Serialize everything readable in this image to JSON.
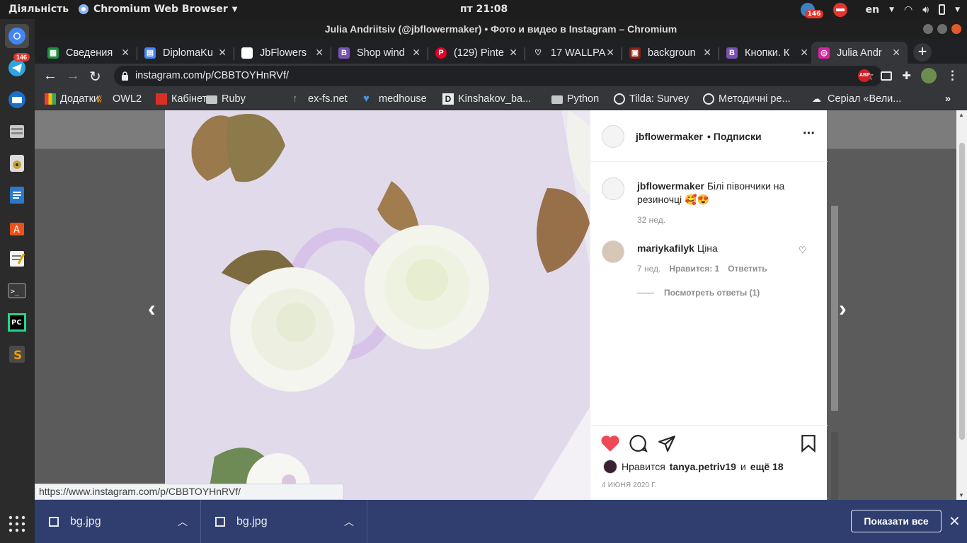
{
  "topbar": {
    "activities": "Діяльність",
    "app_name": "Chromium Web Browser",
    "clock": "пт 21:08",
    "lang": "en",
    "badge_count": "146"
  },
  "dock": {
    "telegram_badge": "146"
  },
  "window": {
    "title": "Julia Andriitsiv (@jbflowermaker) • Фото и видео в Instagram – Chromium"
  },
  "tabs": [
    {
      "label": "Сведения",
      "color": "#1e8e3e",
      "glyph": "▦"
    },
    {
      "label": "DiplomaKu",
      "color": "#4285f4",
      "glyph": "▤"
    },
    {
      "label": "JbFlowers",
      "color": "#ffffff",
      "glyph": ""
    },
    {
      "label": "Shop wind",
      "color": "#7952b3",
      "glyph": "B"
    },
    {
      "label": "(129) Pinte",
      "color": "#e60023",
      "glyph": "P"
    },
    {
      "label": "17 WALLPA",
      "color": "#202124",
      "glyph": "♡"
    },
    {
      "label": "backgroun",
      "color": "#8b1e12",
      "glyph": "▣"
    },
    {
      "label": "Кнопки. К",
      "color": "#7952b3",
      "glyph": "B"
    },
    {
      "label": "Julia Andr",
      "color": "#d6249f",
      "glyph": "◎"
    }
  ],
  "address": {
    "url": "instagram.com/p/CBBTOYHnRVf/"
  },
  "bookmarks": [
    {
      "label": "Додатки"
    },
    {
      "label": "OWL2"
    },
    {
      "label": "Кабінет"
    },
    {
      "label": "Ruby"
    },
    {
      "label": "ex-fs.net"
    },
    {
      "label": "medhouse"
    },
    {
      "label": "Kinshakov_ba..."
    },
    {
      "label": "Python"
    },
    {
      "label": "Tilda: Survey"
    },
    {
      "label": "Методичні ре..."
    },
    {
      "label": "Серіал «Вели..."
    }
  ],
  "post": {
    "author": "jbflowermaker",
    "follow_status": "• Подписки",
    "caption_author": "jbflowermaker",
    "caption_text": "Білі півончики на резиночці 🥰😍",
    "caption_time": "32 нед.",
    "comment_author": "mariykafilyk",
    "comment_text": "Ціна",
    "comment_time": "7 нед.",
    "comment_likes": "Нравится: 1",
    "comment_reply": "Ответить",
    "view_replies": "Посмотреть ответы (1)",
    "likes_prefix": "Нравится",
    "likes_user": "tanya.petriv19",
    "likes_and": "и",
    "likes_more": "ещё 18",
    "date": "4 ИЮНЯ 2020 Г."
  },
  "status_url": "https://www.instagram.com/p/CBBTOYHnRVf/",
  "downloads": {
    "items": [
      {
        "name": "bg.jpg"
      },
      {
        "name": "bg.jpg"
      }
    ],
    "show_all": "Показати все"
  }
}
